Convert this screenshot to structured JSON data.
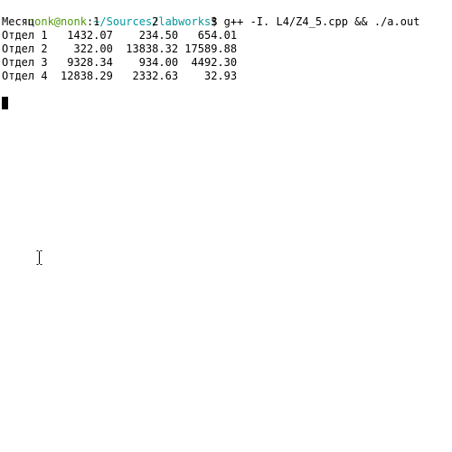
{
  "prompt": {
    "user_host": "nonk@nonk",
    "separator": ":",
    "path": "~/Sources/labworks",
    "symbol": "$",
    "command": " g++ -I. L4/Z4_5.cpp && ./a.out"
  },
  "output": {
    "lines": [
      "Месяц         1        2        3",
      "Отдел 1   1432.07    234.50   654.01",
      "Отдел 2    322.00  13838.32 17589.88",
      "Отдел 3   9328.34    934.00  4492.30",
      "Отдел 4  12838.29   2332.63    32.93"
    ]
  },
  "icons": {
    "cursor": "block-cursor-icon",
    "mouse": "text-ibeam-cursor-icon"
  },
  "colors": {
    "background": "#ffffff",
    "text": "#000000",
    "prompt_user": "#4e9a06",
    "prompt_path": "#06989a"
  }
}
